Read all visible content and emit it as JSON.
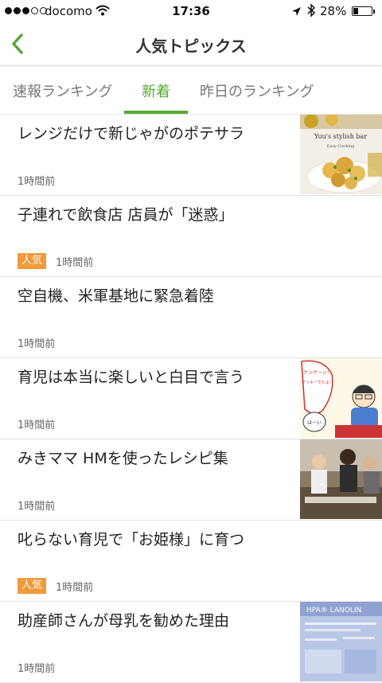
{
  "status_bar": {
    "carrier": "docomo",
    "time": "17:36",
    "battery_percent": "28%",
    "battery_level": 0.28,
    "signal_bars_filled": 3,
    "signal_bars_total": 5
  },
  "nav": {
    "title": "人気トピックス",
    "back_icon": "chevron-left-icon",
    "accent_color": "#55a832"
  },
  "tabs": [
    {
      "label": "速報ランキング",
      "active": false
    },
    {
      "label": "新着",
      "active": true
    },
    {
      "label": "昨日のランキング",
      "active": false
    }
  ],
  "items": [
    {
      "title": "レンジだけで新じゃがのポテサラ",
      "time": "1時間前",
      "badge": "",
      "thumb": "food-photo",
      "thumb_text": [
        "Yuu's stylish bar",
        "Easy Cooking"
      ]
    },
    {
      "title": "子連れで飲食店 店員が「迷惑」",
      "time": "1時間前",
      "badge": "人気",
      "thumb": ""
    },
    {
      "title": "空自機、米軍基地に緊急着陸",
      "time": "1時間前",
      "badge": "",
      "thumb": ""
    },
    {
      "title": "育児は本当に楽しいと白目で言う",
      "time": "1時間前",
      "badge": "",
      "thumb": "manga-illustration",
      "thumb_text": [
        "ケンケーン！",
        "アッキーでたよ！",
        "はーい"
      ]
    },
    {
      "title": "みきママ HMを使ったレシピ集",
      "time": "1時間前",
      "badge": "",
      "thumb": "kitchen-photo"
    },
    {
      "title": "叱らない育児で「お姫様」に育つ",
      "time": "1時間前",
      "badge": "人気",
      "thumb": ""
    },
    {
      "title": "助産師さんが母乳を勧めた理由",
      "time": "1時間前",
      "badge": "",
      "thumb": "product-box-photo",
      "thumb_text": [
        "HPA® LANOLIN"
      ]
    }
  ]
}
